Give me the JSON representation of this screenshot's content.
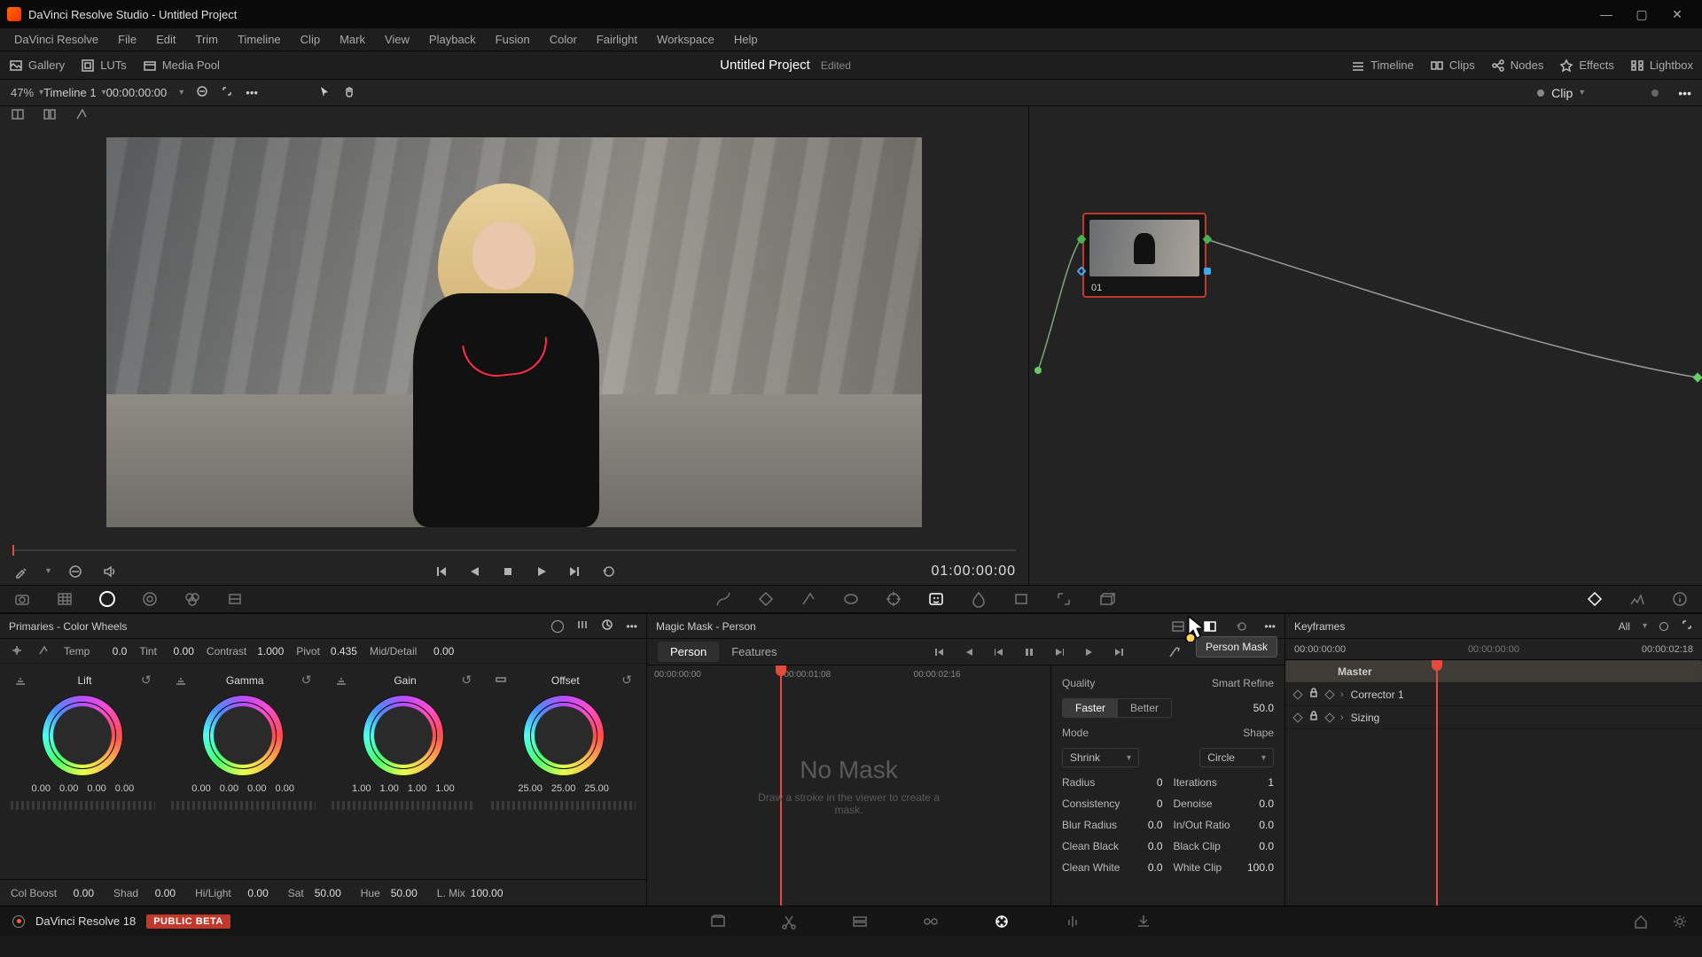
{
  "app": {
    "title": "DaVinci Resolve Studio - Untitled Project"
  },
  "windowControls": {
    "min": "—",
    "max": "▢",
    "close": "✕"
  },
  "menu": [
    "DaVinci Resolve",
    "File",
    "Edit",
    "Trim",
    "Timeline",
    "Clip",
    "Mark",
    "View",
    "Playback",
    "Fusion",
    "Color",
    "Fairlight",
    "Workspace",
    "Help"
  ],
  "toptool": {
    "left": {
      "gallery": "Gallery",
      "luts": "LUTs",
      "mediaPool": "Media Pool"
    },
    "project": "Untitled Project",
    "status": "Edited",
    "right": {
      "timeline": "Timeline",
      "clips": "Clips",
      "nodes": "Nodes",
      "effects": "Effects",
      "lightbox": "Lightbox"
    }
  },
  "viewerHeader": {
    "zoom": "47%",
    "timelineName": "Timeline 1",
    "sourceTc": "00:00:00:00",
    "clipLabel": "Clip"
  },
  "transport": {
    "tc": "01:00:00:00"
  },
  "node": {
    "label": "01"
  },
  "primaries": {
    "title": "Primaries - Color Wheels",
    "params": {
      "tempL": "Temp",
      "temp": "0.0",
      "tintL": "Tint",
      "tint": "0.00",
      "contrastL": "Contrast",
      "contrast": "1.000",
      "pivotL": "Pivot",
      "pivot": "0.435",
      "mdL": "Mid/Detail",
      "md": "0.00"
    },
    "wheels": {
      "lift": {
        "name": "Lift",
        "nums": [
          "0.00",
          "0.00",
          "0.00",
          "0.00"
        ]
      },
      "gamma": {
        "name": "Gamma",
        "nums": [
          "0.00",
          "0.00",
          "0.00",
          "0.00"
        ]
      },
      "gain": {
        "name": "Gain",
        "nums": [
          "1.00",
          "1.00",
          "1.00",
          "1.00"
        ]
      },
      "offset": {
        "name": "Offset",
        "nums": [
          "25.00",
          "25.00",
          "25.00"
        ]
      }
    },
    "footer": {
      "colBoostL": "Col Boost",
      "colBoost": "0.00",
      "shadL": "Shad",
      "shad": "0.00",
      "hiLightL": "Hi/Light",
      "hiLight": "0.00",
      "satL": "Sat",
      "sat": "50.00",
      "hueL": "Hue",
      "hue": "50.00",
      "lmixL": "L. Mix",
      "lmix": "100.00"
    }
  },
  "magicMask": {
    "title": "Magic Mask - Person",
    "tabs": {
      "person": "Person",
      "features": "Features"
    },
    "ruler": [
      "00:00:00:00",
      "00:00:01:08",
      "00:00:02:16"
    ],
    "noMask": "No Mask",
    "noMaskSub": "Draw a stroke in the viewer to create a mask.",
    "tooltip": "Person Mask",
    "params": {
      "qualityL": "Quality",
      "faster": "Faster",
      "better": "Better",
      "smartRefineL": "Smart Refine",
      "smartRefine": "50.0",
      "modeL": "Mode",
      "mode": "Shrink",
      "shapeL": "Shape",
      "shape": "Circle",
      "radiusL": "Radius",
      "radius": "0",
      "iterL": "Iterations",
      "iter": "1",
      "consistencyL": "Consistency",
      "consistency": "0",
      "denoiseL": "Denoise",
      "denoise": "0.0",
      "blurL": "Blur Radius",
      "blur": "0.0",
      "ioL": "In/Out Ratio",
      "io": "0.0",
      "cbL": "Clean Black",
      "cb": "0.0",
      "bcL": "Black Clip",
      "bc": "0.0",
      "cwL": "Clean White",
      "cw": "0.0",
      "wcL": "White Clip",
      "wc": "100.0"
    }
  },
  "keyframes": {
    "title": "Keyframes",
    "filter": "All",
    "tcStart": "00:00:00:00",
    "tcPlay": "00:00:00:00",
    "tcEnd": "00:00:02:18",
    "rows": {
      "master": "Master",
      "corrector": "Corrector 1",
      "sizing": "Sizing"
    }
  },
  "pagebar": {
    "name": "DaVinci Resolve 18",
    "tag": "PUBLIC BETA"
  }
}
